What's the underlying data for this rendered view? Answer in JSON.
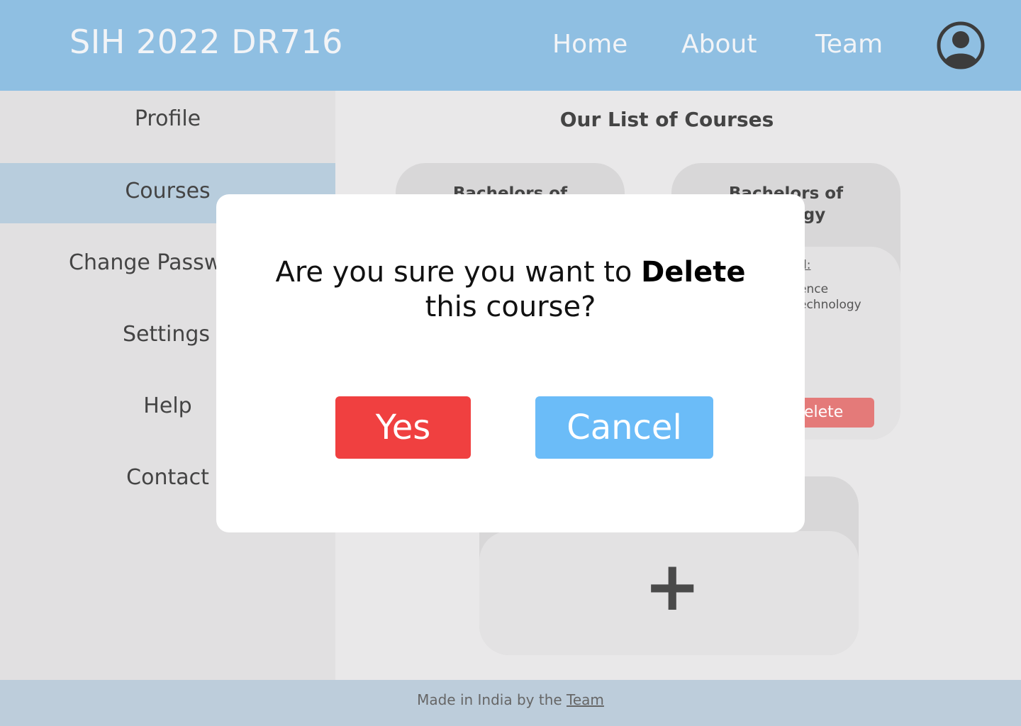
{
  "header": {
    "brand": "SIH 2022 DR716",
    "nav": [
      "Home",
      "About",
      "Team"
    ],
    "avatar_icon": "user-circle-icon"
  },
  "sidebar": {
    "items": [
      {
        "label": "Profile"
      },
      {
        "label": "Courses",
        "active": true
      },
      {
        "label": "Change Password"
      },
      {
        "label": "Settings"
      },
      {
        "label": "Help"
      },
      {
        "label": "Contact"
      }
    ]
  },
  "main": {
    "title": "Our List of Courses",
    "cards": [
      {
        "title": "Bachelors of"
      },
      {
        "title": "Bachelors of",
        "title_line2": "ogy",
        "fragment_1": "d:",
        "fragment_2": "ence",
        "fragment_3": "echnology",
        "delete_label": "Delete"
      }
    ],
    "add_icon": "plus-icon",
    "add_glyph": "+"
  },
  "footer": {
    "text": "Made in India by the ",
    "link": "Team"
  },
  "modal": {
    "message_pre": "Are you sure you want to ",
    "message_bold": "Delete",
    "message_post": "this course?",
    "yes_label": "Yes",
    "cancel_label": "Cancel"
  },
  "colors": {
    "header": "#8fbfe2",
    "sidebar_active": "#b8cddd",
    "footer": "#bdcddb",
    "yes": "#f04040",
    "cancel": "#6bbcf8",
    "delete": "#e47a79"
  }
}
